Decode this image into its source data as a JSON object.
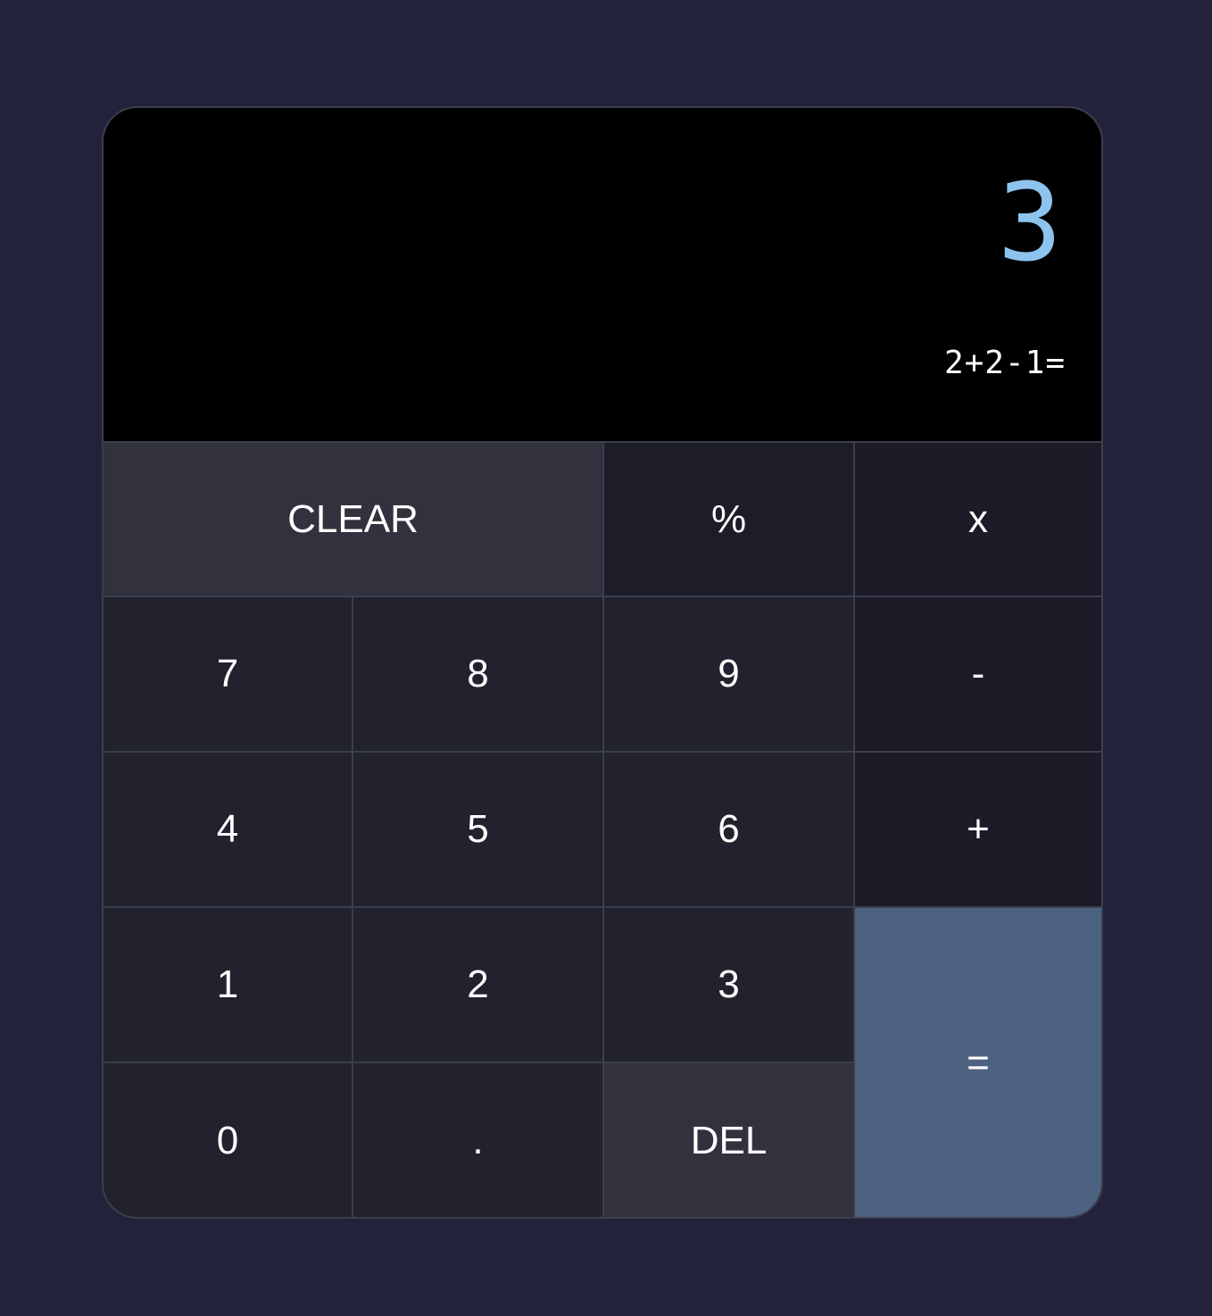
{
  "display": {
    "result": "3",
    "expression": "2+2-1="
  },
  "keys": {
    "clear": "CLEAR",
    "percent": "%",
    "multiply": "x",
    "seven": "7",
    "eight": "8",
    "nine": "9",
    "subtract": "-",
    "four": "4",
    "five": "5",
    "six": "6",
    "add": "+",
    "one": "1",
    "two": "2",
    "three": "3",
    "equals": "=",
    "zero": "0",
    "dot": ".",
    "delete": "DEL"
  },
  "colors": {
    "background": "#22223a",
    "display_bg": "#000000",
    "result_text": "#8cc4ee",
    "number_key": "#22222e",
    "operator_key": "#1c1b27",
    "function_key": "#32323e",
    "equals_key": "#4d6281",
    "border": "#3b3f4c"
  }
}
